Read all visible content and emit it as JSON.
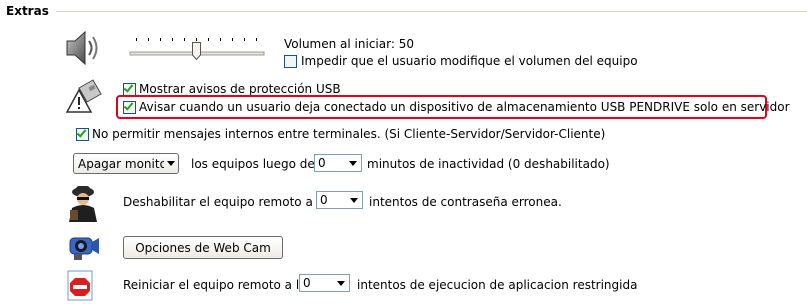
{
  "section": {
    "title": "Extras"
  },
  "volume": {
    "label": "Volumen al iniciar: 50",
    "level": 50,
    "prevent_label": "Impedir que el usuario modifique el volumen del equipo",
    "prevent_checked": false
  },
  "usb": {
    "show_warnings_label": "Mostrar avisos de protección USB",
    "show_warnings_checked": true,
    "pendrive_label": "Avisar cuando un usuario deja conectado un dispositivo de almacenamiento USB PENDRIVE solo en servidor",
    "pendrive_checked": true
  },
  "messages": {
    "label": "No permitir mensajes internos entre terminales. (Si Cliente-Servidor/Servidor-Cliente)",
    "checked": true
  },
  "monitor": {
    "action_value": "Apagar monito",
    "text_before": "los equipos luego de",
    "minutes_value": "0",
    "text_after": "minutos de inactividad (0 deshabilitado)"
  },
  "password": {
    "text_before": "Deshabilitar el equipo remoto a los",
    "attempts_value": "0",
    "text_after": "intentos de contraseña erronea."
  },
  "webcam": {
    "button_label": "Opciones de Web Cam"
  },
  "restricted": {
    "text_before": "Reiniciar el equipo remoto a los",
    "attempts_value": "0",
    "text_after": "intentos de ejecucion de aplicacion restringida"
  },
  "colors": {
    "highlight": "#e2001a",
    "check": "#21a121"
  }
}
